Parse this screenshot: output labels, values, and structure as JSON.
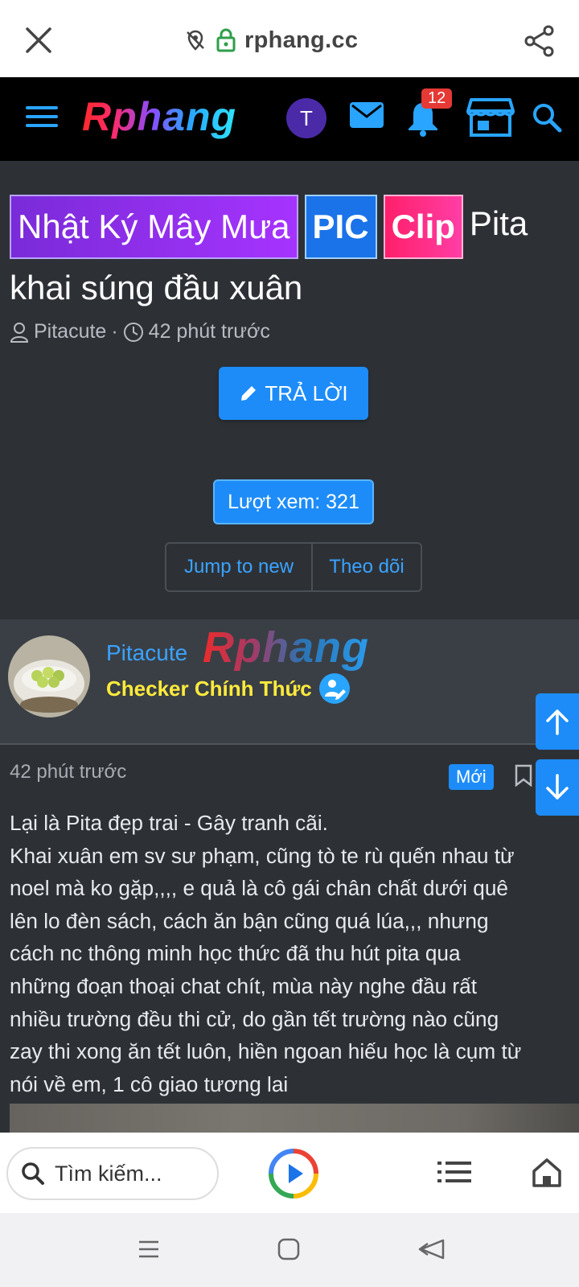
{
  "browser": {
    "url": "rphang.cc",
    "icons": [
      "close-icon",
      "tracking-off-icon",
      "lock-icon",
      "share-icon"
    ]
  },
  "site_header": {
    "logo": "Rphang",
    "user_initial": "T",
    "notification_count": "12",
    "icons": [
      "menu-icon",
      "mail-icon",
      "bell-icon",
      "store-icon",
      "search-icon"
    ],
    "colors": {
      "accent": "#29a5ff",
      "background": "#000000",
      "avatar": "#4b2aa8"
    }
  },
  "thread": {
    "prefixes": [
      "Nhật Ký Mây Mưa",
      "PIC",
      "Clip"
    ],
    "title": "Pita khai súng đầu xuân",
    "author": "Pitacute",
    "time": "42 phút trước",
    "reply_label": "TRẢ LỜI",
    "views_label": "Lượt xem: 321",
    "jump_label": "Jump to new",
    "follow_label": "Theo dõi"
  },
  "post": {
    "author_name": "Pitacute",
    "author_title": "Checker Chính Thức",
    "watermark": "Rphang",
    "time": "42 phút trước",
    "new_badge": "Mới",
    "lines": [
      "Lại là Pita đẹp trai - Gây tranh cãi.",
      "Khai xuân em sv sư phạm, cũng tò te rù quến nhau từ",
      "noel mà ko gặp,,,, e quả là cô gái chân chất dưới quê",
      "lên lo đèn sách, cách ăn bận cũng quá lúa,,, nhưng",
      "cách nc thông minh học thức đã thu hút pita qua",
      "những đoạn thoại chat chít, mùa này nghe đầu rất",
      "nhiều trường đều thi cử, do gần tết trường nào cũng",
      "zay thi xong ăn tết luôn, hiền ngoan hiếu học là cụm từ",
      "nói về em, 1 cô giao tương lai"
    ]
  },
  "bottom_bar": {
    "search_placeholder": "Tìm kiếm...",
    "icons": [
      "search-icon",
      "play-icon",
      "list-icon",
      "home-icon"
    ]
  },
  "system_nav": {
    "icons": [
      "recent-apps-icon",
      "home-icon",
      "back-icon"
    ]
  }
}
